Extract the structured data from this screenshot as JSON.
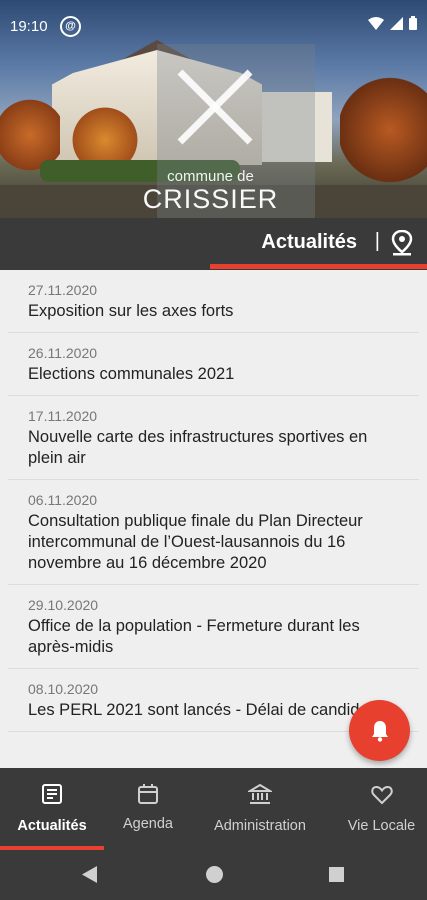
{
  "status_bar": {
    "time": "19:10",
    "notification_glyph": "@"
  },
  "header": {
    "logo_line1": "commune de",
    "logo_line2": "CRISSIER",
    "section_title": "Actualités",
    "separator": "|"
  },
  "news": [
    {
      "date": "27.11.2020",
      "title": "Exposition sur les axes forts"
    },
    {
      "date": "26.11.2020",
      "title": "Elections communales 2021"
    },
    {
      "date": "17.11.2020",
      "title": "Nouvelle carte des infrastructures sportives en plein air"
    },
    {
      "date": "06.11.2020",
      "title": "Consultation publique finale du Plan Directeur intercommunal de l’Ouest-lausannois du 16 novembre au 16 décembre 2020"
    },
    {
      "date": "29.10.2020",
      "title": "Office de la population - Fermeture durant les après-midis"
    },
    {
      "date": "08.10.2020",
      "title": "Les PERL 2021 sont lancés - Délai de candidature"
    }
  ],
  "bottom_nav": [
    {
      "label": "Actualités",
      "icon": "newspaper-icon",
      "active": true
    },
    {
      "label": "Agenda",
      "icon": "calendar-icon",
      "active": false
    },
    {
      "label": "Administration",
      "icon": "bank-icon",
      "active": false
    },
    {
      "label": "Vie Locale",
      "icon": "heart-icon",
      "active": false
    }
  ],
  "colors": {
    "accent": "#e8402f",
    "dark_bar": "#3a3a3a",
    "background": "#efefef"
  }
}
